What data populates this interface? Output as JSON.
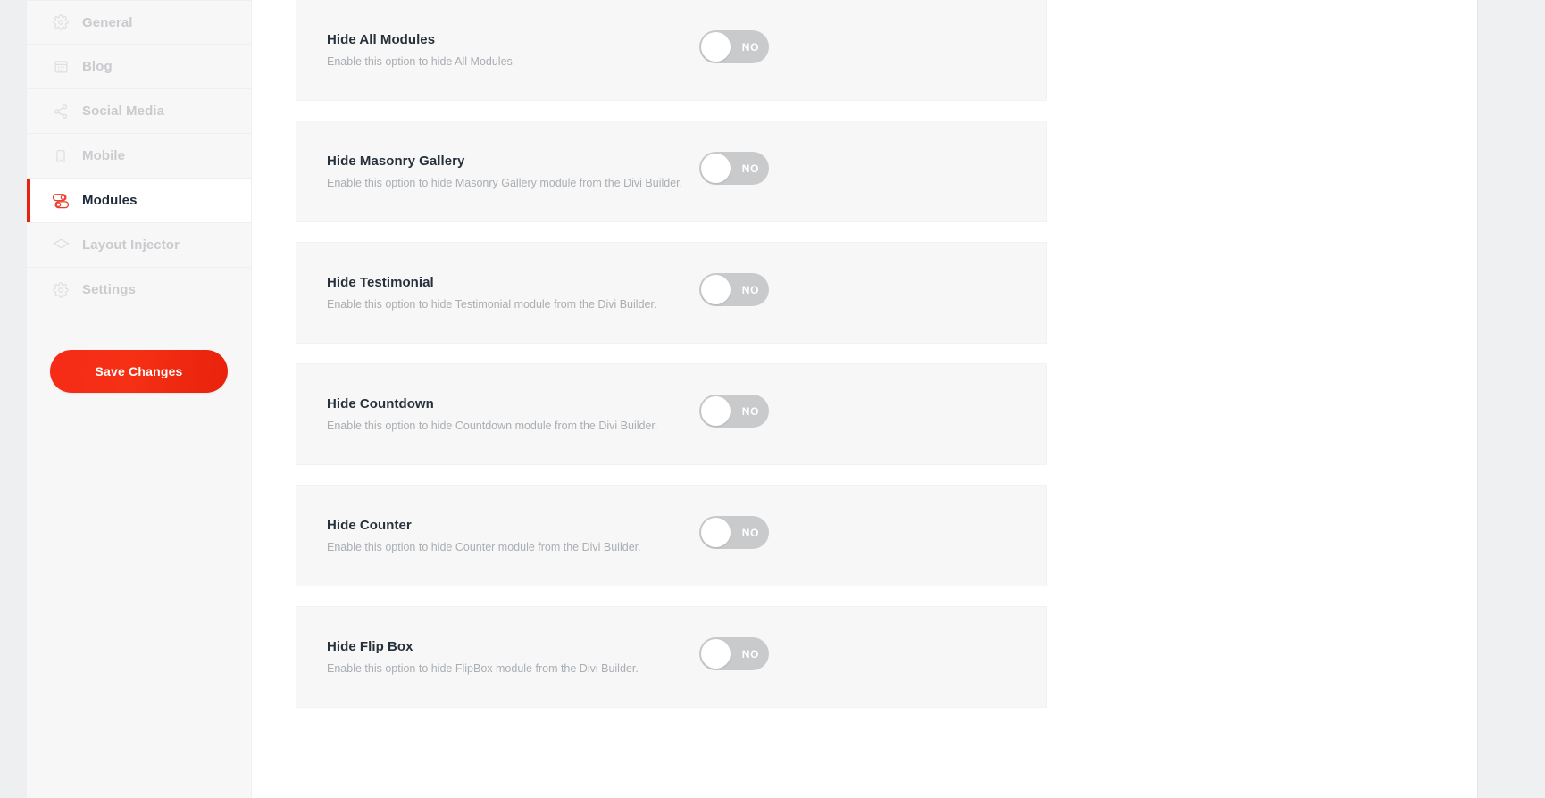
{
  "sidebar": {
    "items": [
      {
        "label": "General",
        "icon": "gear-icon",
        "active": false
      },
      {
        "label": "Blog",
        "icon": "calendar-grid-icon",
        "active": false
      },
      {
        "label": "Social Media",
        "icon": "share-nodes-icon",
        "active": false
      },
      {
        "label": "Mobile",
        "icon": "mobile-device-icon",
        "active": false
      },
      {
        "label": "Modules",
        "icon": "toggle-pair-icon",
        "active": true
      },
      {
        "label": "Layout Injector",
        "icon": "layers-icon",
        "active": false
      },
      {
        "label": "Settings",
        "icon": "gear-icon",
        "active": false
      }
    ],
    "save_button_label": "Save Changes"
  },
  "colors": {
    "accent_red": "#e8220c",
    "sidebar_bg": "#f7f7f7",
    "card_bg": "#f7f7f7",
    "switch_off_track": "#c8cacc",
    "title_text": "#27313c",
    "muted_text": "#a9aeb3",
    "right_panel_bg": "#eff0f1"
  },
  "main": {
    "options": [
      {
        "title": "Hide All Modules",
        "description": "Enable this option to hide All Modules.",
        "switch_label": "NO",
        "switch_state": "off"
      },
      {
        "title": "Hide Masonry Gallery",
        "description": "Enable this option to hide Masonry Gallery module from the Divi Builder.",
        "switch_label": "NO",
        "switch_state": "off"
      },
      {
        "title": "Hide Testimonial",
        "description": "Enable this option to hide Testimonial module from the Divi Builder.",
        "switch_label": "NO",
        "switch_state": "off"
      },
      {
        "title": "Hide Countdown",
        "description": "Enable this option to hide Countdown module from the Divi Builder.",
        "switch_label": "NO",
        "switch_state": "off"
      },
      {
        "title": "Hide Counter",
        "description": "Enable this option to hide Counter module from the Divi Builder.",
        "switch_label": "NO",
        "switch_state": "off"
      },
      {
        "title": "Hide Flip Box",
        "description": "Enable this option to hide FlipBox module from the Divi Builder.",
        "switch_label": "NO",
        "switch_state": "off"
      }
    ]
  }
}
